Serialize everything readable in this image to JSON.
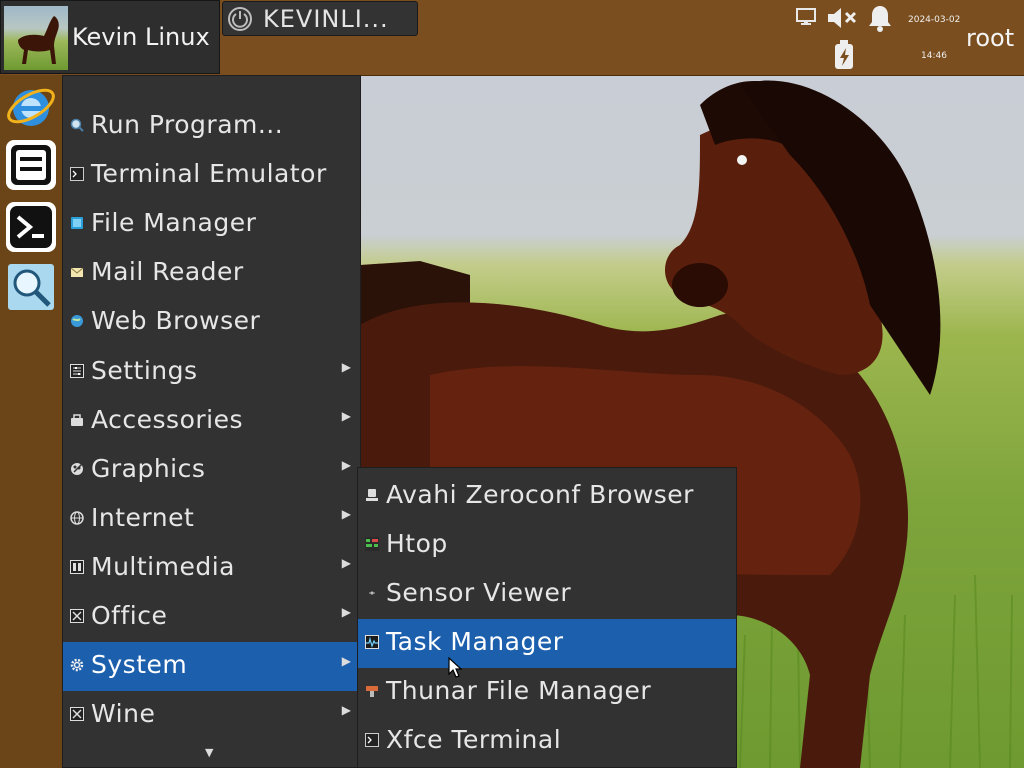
{
  "panel": {
    "app_name": "Kevin Linux",
    "task_title": "KEVINLI...",
    "date": "2024-03-02",
    "time": "14:46",
    "user": "root"
  },
  "tray": {
    "icons": [
      "network-icon",
      "volume-muted-icon",
      "notification-bell-icon",
      "battery-charging-icon"
    ]
  },
  "launcher": {
    "icons": [
      "internet-explorer-icon",
      "file-manager-icon",
      "terminal-icon",
      "search-app-icon"
    ]
  },
  "main_menu": {
    "items": [
      {
        "label": "Run Program...",
        "icon": "run-program-icon",
        "submenu": false
      },
      {
        "label": "Terminal Emulator",
        "icon": "terminal-icon",
        "submenu": false
      },
      {
        "label": "File Manager",
        "icon": "folder-icon",
        "submenu": false
      },
      {
        "label": "Mail Reader",
        "icon": "mail-icon",
        "submenu": false
      },
      {
        "label": "Web Browser",
        "icon": "globe-icon",
        "submenu": false
      },
      {
        "label": "Settings",
        "icon": "settings-icon",
        "submenu": true
      },
      {
        "label": "Accessories",
        "icon": "accessories-icon",
        "submenu": true
      },
      {
        "label": "Graphics",
        "icon": "graphics-icon",
        "submenu": true
      },
      {
        "label": "Internet",
        "icon": "internet-icon",
        "submenu": true
      },
      {
        "label": "Multimedia",
        "icon": "multimedia-icon",
        "submenu": true
      },
      {
        "label": "Office",
        "icon": "office-icon",
        "submenu": true
      },
      {
        "label": "System",
        "icon": "gear-icon",
        "submenu": true,
        "selected": true
      },
      {
        "label": "Wine",
        "icon": "wine-icon",
        "submenu": true
      }
    ]
  },
  "system_submenu": {
    "items": [
      {
        "label": "Avahi Zeroconf Browser",
        "icon": "avahi-icon"
      },
      {
        "label": "Htop",
        "icon": "htop-icon"
      },
      {
        "label": "Sensor Viewer",
        "icon": "sensor-icon"
      },
      {
        "label": "Task Manager",
        "icon": "task-manager-icon",
        "selected": true
      },
      {
        "label": "Thunar File Manager",
        "icon": "thunar-icon"
      },
      {
        "label": "Xfce Terminal",
        "icon": "xfce-terminal-icon"
      }
    ]
  },
  "colors": {
    "panel": "#7a4e1e",
    "menu_bg": "#323232",
    "selection": "#1c5fad",
    "menu_text": "#e6e6e6"
  }
}
